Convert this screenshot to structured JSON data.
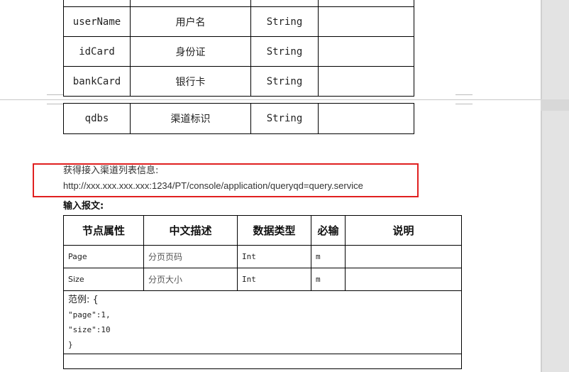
{
  "table_top": {
    "rows": [
      {
        "field": "",
        "desc": "",
        "type": "",
        "note": ""
      },
      {
        "field": "userName",
        "desc": "用户名",
        "type": "String",
        "note": ""
      },
      {
        "field": "idCard",
        "desc": "身份证",
        "type": "String",
        "note": ""
      },
      {
        "field": "bankCard",
        "desc": "银行卡",
        "type": "String",
        "note": ""
      }
    ]
  },
  "table_continued": {
    "rows": [
      {
        "field": "qdbs",
        "desc": "渠道标识",
        "type": "String",
        "note": ""
      }
    ]
  },
  "section": {
    "heading": "获得接入渠道列表信息:",
    "url": "http://xxx.xxx.xxx.xxx:1234/PT/console/application/queryqd=query.service",
    "input_label": "输入报文:"
  },
  "input_table": {
    "headers": [
      "节点属性",
      "中文描述",
      "数据类型",
      "必输",
      "说明"
    ],
    "rows": [
      {
        "node": "Page",
        "desc": "分页页码",
        "type": "Int",
        "required": "m",
        "note": ""
      },
      {
        "node": "Size",
        "desc": "分页大小",
        "type": "Int",
        "required": "m",
        "note": ""
      }
    ],
    "example": [
      "范例: {",
      "\"page\":1,",
      "\"size\":10",
      "}"
    ]
  },
  "colors": {
    "highlight_border": "#e02020",
    "gutter": "#e3e3e3"
  }
}
